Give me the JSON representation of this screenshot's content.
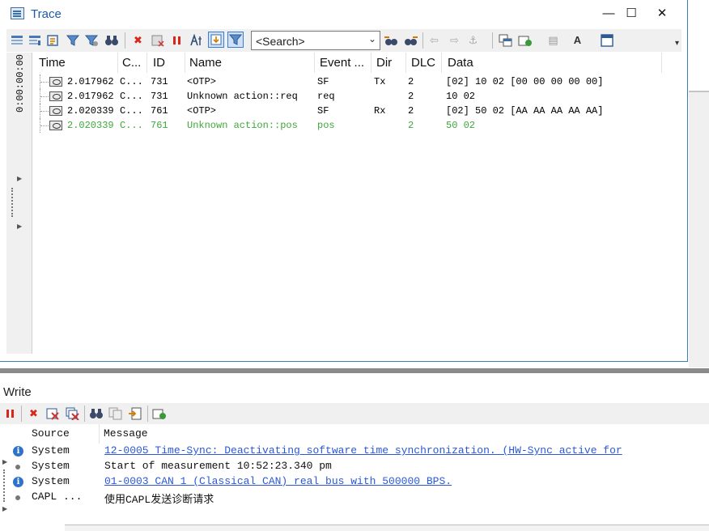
{
  "trace": {
    "title": "Trace",
    "controls": {
      "minimize": "—",
      "maximize": "☐",
      "close": "✕"
    },
    "search_placeholder": "<Search>",
    "time_offset": "0:00:00:00",
    "columns": [
      "Time",
      "C...",
      "ID",
      "Name",
      "Event ...",
      "Dir",
      "DLC",
      "Data"
    ],
    "rows": [
      {
        "time": "2.017962",
        "chn": "C...",
        "id": "731",
        "name": "<OTP>",
        "event": "SF",
        "dir": "Tx",
        "dlc": "2",
        "data": "[02] 10 02 [00 00 00 00 00]"
      },
      {
        "time": "2.017962",
        "chn": "C...",
        "id": "731",
        "name": "Unknown action::req",
        "event": "req",
        "dir": "",
        "dlc": "2",
        "data": "10 02"
      },
      {
        "time": "2.020339",
        "chn": "C...",
        "id": "761",
        "name": "<OTP>",
        "event": "SF",
        "dir": "Rx",
        "dlc": "2",
        "data": "[02] 50 02 [AA AA AA AA AA]"
      },
      {
        "time": "2.020339",
        "chn": "C...",
        "id": "761",
        "name": "Unknown action::pos",
        "event": "pos",
        "dir": "",
        "dlc": "2",
        "data": "50 02"
      }
    ]
  },
  "write": {
    "title": "Write",
    "columns": [
      "Source",
      "Message"
    ],
    "rows": [
      {
        "icon": "info-icon",
        "source": "System",
        "message": "12-0005 Time-Sync: Deactivating software time synchronization. (HW-Sync active for",
        "link": true
      },
      {
        "icon": "bullet-icon",
        "source": "System",
        "message": "Start of measurement 10:52:23.340 pm",
        "link": false
      },
      {
        "icon": "info-icon",
        "source": "System",
        "message": "01-0003 CAN 1 (Classical CAN)  real bus with 500000 BPS.",
        "link": true
      },
      {
        "icon": "bullet-icon",
        "source": "CAPL ...",
        "message": "使用CAPL发送诊断请求",
        "link": false
      }
    ]
  },
  "colors": {
    "accent": "#1c5aa8",
    "link": "#2b58d8",
    "green_row": "#3fa73b",
    "info": "#2f73c9"
  }
}
